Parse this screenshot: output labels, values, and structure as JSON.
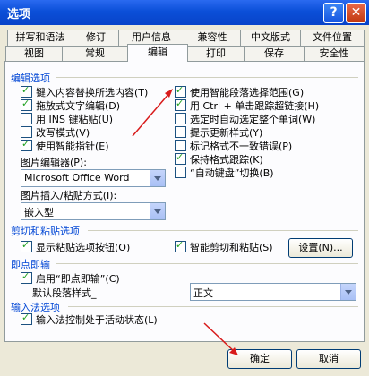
{
  "window": {
    "title": "选项",
    "help": "?",
    "close": "✕"
  },
  "tabs_row1": [
    "拼写和语法",
    "修订",
    "用户信息",
    "兼容性",
    "中文版式",
    "文件位置"
  ],
  "tabs_row2": [
    "视图",
    "常规",
    "编辑",
    "打印",
    "保存",
    "安全性"
  ],
  "active_tab": "编辑",
  "edit_section": {
    "title": "编辑选项",
    "left": [
      {
        "label": "键入内容替换所选内容(T)",
        "checked": true
      },
      {
        "label": "拖放式文字编辑(D)",
        "checked": true
      },
      {
        "label": "用 INS 键粘贴(U)",
        "checked": false
      },
      {
        "label": "改写模式(V)",
        "checked": false
      },
      {
        "label": "使用智能指针(E)",
        "checked": true
      }
    ],
    "right": [
      {
        "label": "使用智能段落选择范围(G)",
        "checked": true
      },
      {
        "label": "用 Ctrl + 单击跟踪超链接(H)",
        "checked": true
      },
      {
        "label": "选定时自动选定整个单词(W)",
        "checked": false
      },
      {
        "label": "提示更新样式(Y)",
        "checked": false
      },
      {
        "label": "标记格式不一致错误(P)",
        "checked": false
      },
      {
        "label": "保持格式跟踪(K)",
        "checked": true
      },
      {
        "label": "“自动键盘”切换(B)",
        "checked": false
      }
    ],
    "picture_editor_label": "图片编辑器(P):",
    "picture_editor_value": "Microsoft Office Word",
    "insert_paste_label": "图片插入/粘贴方式(I):",
    "insert_paste_value": "嵌入型"
  },
  "cut_paste": {
    "title": "剪切和粘贴选项",
    "show_buttons": {
      "label": "显示粘贴选项按钮(O)",
      "checked": true
    },
    "smart_cut": {
      "label": "智能剪切和粘贴(S)",
      "checked": true
    },
    "settings_button": "设置(N)..."
  },
  "click_type": {
    "title": "即点即输",
    "enable": {
      "label": "启用“即点即输”(C)",
      "checked": true
    },
    "default_style_label": "默认段落样式_",
    "default_style_value": "正文"
  },
  "ime": {
    "title": "输入法选项",
    "control": {
      "label": "输入法控制处于活动状态(L)",
      "checked": true
    }
  },
  "footer": {
    "ok": "确定",
    "cancel": "取消"
  },
  "colors": {
    "annotation_arrow": "#d81b1b",
    "section_label": "#0046d5"
  }
}
